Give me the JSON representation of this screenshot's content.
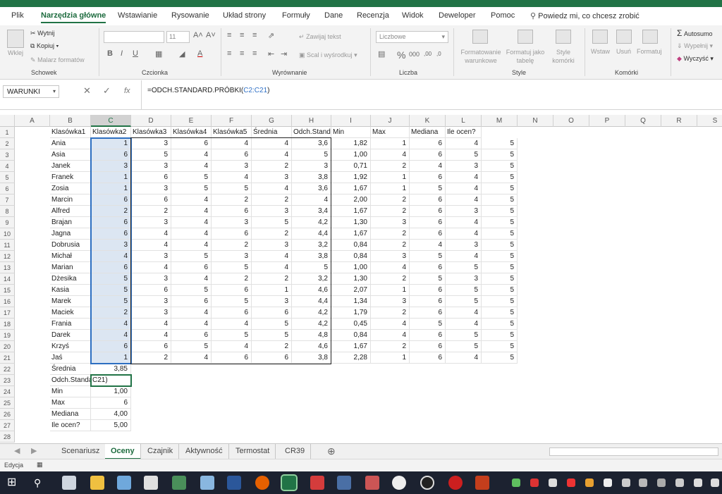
{
  "menu": {
    "tabs": [
      "Plik",
      "Narzędzia główne",
      "Wstawianie",
      "Rysowanie",
      "Układ strony",
      "Formuły",
      "Dane",
      "Recenzja",
      "Widok",
      "Deweloper",
      "Pomoc"
    ],
    "tell_me": "Powiedz mi, co chcesz zrobić"
  },
  "ribbon": {
    "clipboard": {
      "paste": "Wklej",
      "cut": "Wytnij",
      "copy": "Kopiuj",
      "painter": "Malarz formatów",
      "label": "Schowek"
    },
    "font": {
      "size": "11",
      "label": "Czcionka",
      "bold": "B",
      "italic": "I",
      "underline": "U"
    },
    "alignment": {
      "wrap": "Zawijaj tekst",
      "merge": "Scal i wyśrodkuj",
      "label": "Wyrównanie"
    },
    "number": {
      "format": "Liczbowe",
      "label": "Liczba"
    },
    "styles": {
      "conditional": "Formatowanie warunkowe",
      "table": "Formatuj jako tabelę",
      "cell": "Style komórki",
      "label": "Style"
    },
    "cells": {
      "insert": "Wstaw",
      "delete": "Usuń",
      "format": "Formatuj",
      "label": "Komórki"
    },
    "editing": {
      "autosum": "Autosumo",
      "fill": "Wypełnij",
      "clear": "Wyczyść"
    }
  },
  "formula_bar": {
    "name_box": "WARUNKI",
    "fx": "fx",
    "formula_prefix": "=ODCH.STANDARD.PRÓBKI(",
    "formula_ref": "C2:C21",
    "formula_suffix": ")"
  },
  "columns": [
    "A",
    "B",
    "C",
    "D",
    "E",
    "F",
    "G",
    "H",
    "I",
    "J",
    "K",
    "L",
    "M",
    "N",
    "O",
    "P",
    "Q",
    "R",
    "S"
  ],
  "header_row": [
    "",
    "Klasówka1",
    "Klasówka2",
    "Klasówka3",
    "Klasówka4",
    "Klasówka5",
    "Średnia",
    "Odch.Stand",
    "Min",
    "Max",
    "Mediana",
    "Ile ocen?"
  ],
  "students": [
    [
      "Ania",
      "1",
      "3",
      "6",
      "4",
      "4",
      "3,6",
      "1,82",
      "1",
      "6",
      "4",
      "5"
    ],
    [
      "Asia",
      "6",
      "5",
      "4",
      "6",
      "4",
      "5",
      "1,00",
      "4",
      "6",
      "5",
      "5"
    ],
    [
      "Janek",
      "3",
      "3",
      "4",
      "3",
      "2",
      "3",
      "0,71",
      "2",
      "4",
      "3",
      "5"
    ],
    [
      "Franek",
      "1",
      "6",
      "5",
      "4",
      "3",
      "3,8",
      "1,92",
      "1",
      "6",
      "4",
      "5"
    ],
    [
      "Zosia",
      "1",
      "3",
      "5",
      "5",
      "4",
      "3,6",
      "1,67",
      "1",
      "5",
      "4",
      "5"
    ],
    [
      "Marcin",
      "6",
      "6",
      "4",
      "2",
      "2",
      "4",
      "2,00",
      "2",
      "6",
      "4",
      "5"
    ],
    [
      "Alfred",
      "2",
      "2",
      "4",
      "6",
      "3",
      "3,4",
      "1,67",
      "2",
      "6",
      "3",
      "5"
    ],
    [
      "Brajan",
      "6",
      "3",
      "4",
      "3",
      "5",
      "4,2",
      "1,30",
      "3",
      "6",
      "4",
      "5"
    ],
    [
      "Jagna",
      "6",
      "4",
      "4",
      "6",
      "2",
      "4,4",
      "1,67",
      "2",
      "6",
      "4",
      "5"
    ],
    [
      "Dobrusia",
      "3",
      "4",
      "4",
      "2",
      "3",
      "3,2",
      "0,84",
      "2",
      "4",
      "3",
      "5"
    ],
    [
      "Michał",
      "4",
      "3",
      "5",
      "3",
      "4",
      "3,8",
      "0,84",
      "3",
      "5",
      "4",
      "5"
    ],
    [
      "Marian",
      "6",
      "4",
      "6",
      "5",
      "4",
      "5",
      "1,00",
      "4",
      "6",
      "5",
      "5"
    ],
    [
      "Dżesika",
      "5",
      "3",
      "4",
      "2",
      "2",
      "3,2",
      "1,30",
      "2",
      "5",
      "3",
      "5"
    ],
    [
      "Kasia",
      "5",
      "6",
      "5",
      "6",
      "1",
      "4,6",
      "2,07",
      "1",
      "6",
      "5",
      "5"
    ],
    [
      "Marek",
      "5",
      "3",
      "6",
      "5",
      "3",
      "4,4",
      "1,34",
      "3",
      "6",
      "5",
      "5"
    ],
    [
      "Maciek",
      "2",
      "3",
      "4",
      "6",
      "6",
      "4,2",
      "1,79",
      "2",
      "6",
      "4",
      "5"
    ],
    [
      "Frania",
      "4",
      "4",
      "4",
      "4",
      "5",
      "4,2",
      "0,45",
      "4",
      "5",
      "4",
      "5"
    ],
    [
      "Darek",
      "4",
      "4",
      "6",
      "5",
      "5",
      "4,8",
      "0,84",
      "4",
      "6",
      "5",
      "5"
    ],
    [
      "Krzyś",
      "6",
      "6",
      "5",
      "4",
      "2",
      "4,6",
      "1,67",
      "2",
      "6",
      "5",
      "5"
    ],
    [
      "Jaś",
      "1",
      "2",
      "4",
      "6",
      "6",
      "3,8",
      "2,28",
      "1",
      "6",
      "4",
      "5"
    ]
  ],
  "summary": [
    {
      "label": "Średnia",
      "value": "3,85"
    },
    {
      "label": "Odch.Standard",
      "value": "C21)"
    },
    {
      "label": "Min",
      "value": "1,00"
    },
    {
      "label": "Max",
      "value": "6"
    },
    {
      "label": "Mediana",
      "value": "4,00"
    },
    {
      "label": "Ile ocen?",
      "value": "5,00"
    }
  ],
  "sheet_tabs": [
    "Scenariusz",
    "Oceny",
    "Czajnik",
    "Aktywność",
    "Termostat",
    "CR39"
  ],
  "status": {
    "mode": "Edycja"
  },
  "colors": {
    "accent": "#217346",
    "range": "#2d6fc1",
    "selection": "#dce6f2"
  }
}
